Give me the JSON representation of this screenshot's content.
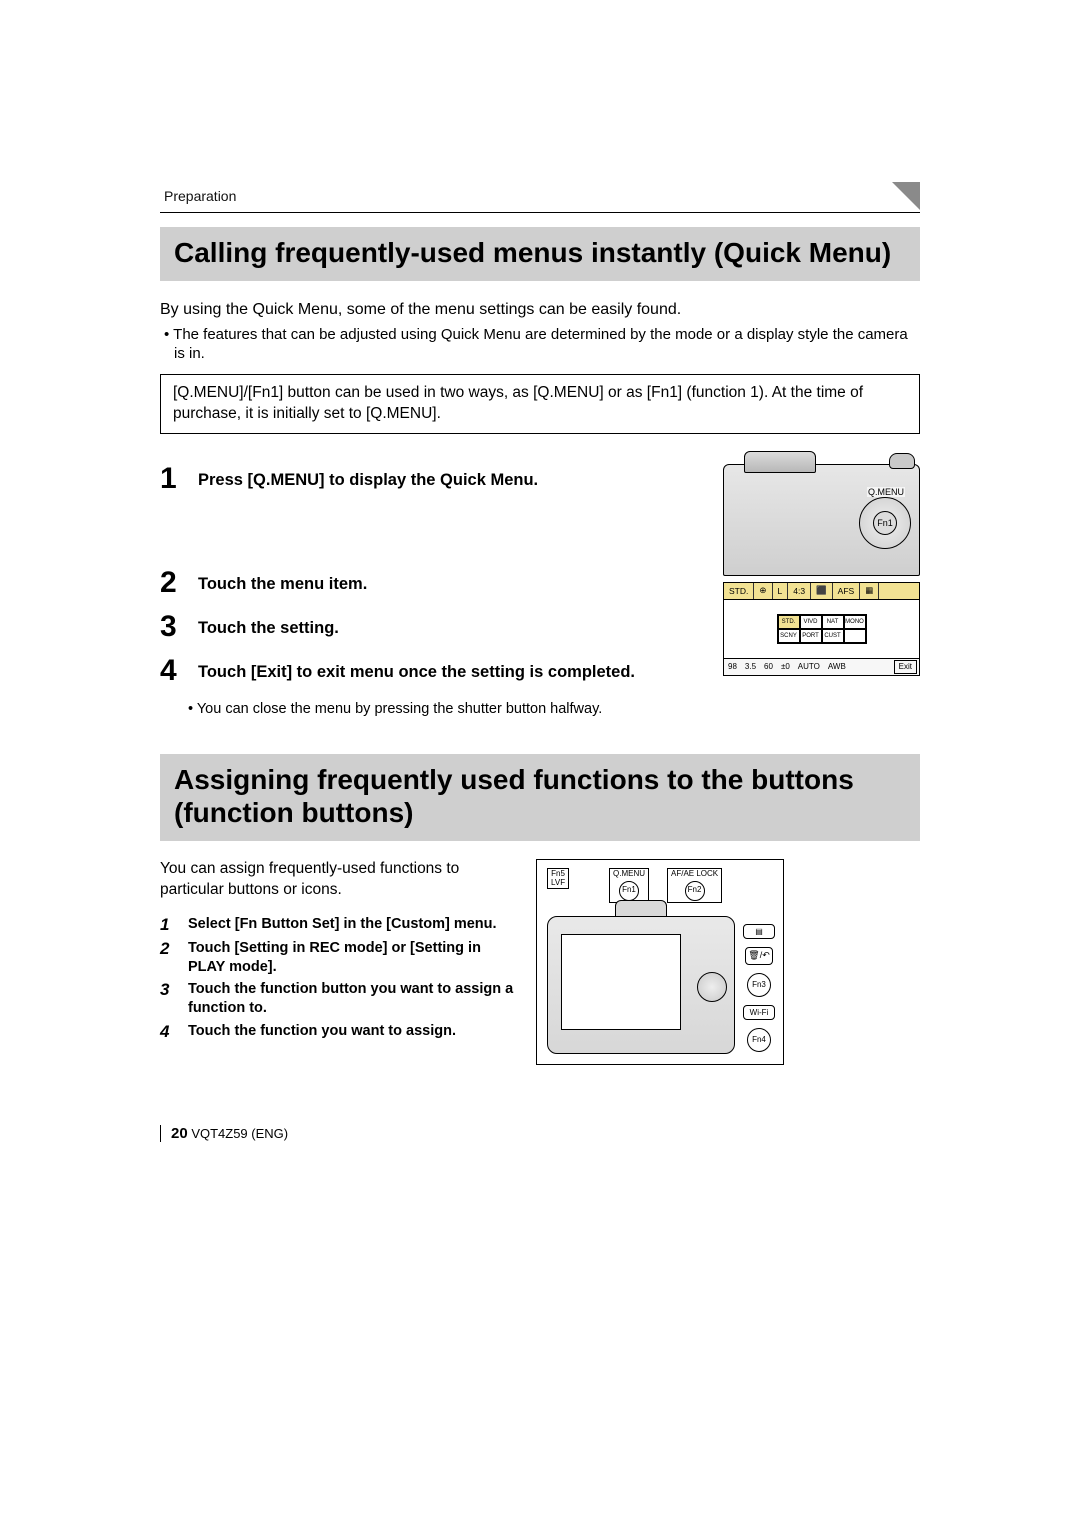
{
  "breadcrumb": "Preparation",
  "section1": {
    "title": "Calling frequently-used menus instantly (Quick Menu)",
    "intro": "By using the Quick Menu, some of the menu settings can be easily found.",
    "bullet": "The features that can be adjusted using Quick Menu are determined by the mode or a display style the camera is in.",
    "box": "[Q.MENU]/[Fn1] button can be used in two ways, as [Q.MENU] or as [Fn1] (function 1). At the time of purchase, it is initially set to [Q.MENU].",
    "steps": [
      {
        "n": "1",
        "t": "Press [Q.MENU] to display the Quick Menu."
      },
      {
        "n": "2",
        "t": "Touch the menu item."
      },
      {
        "n": "3",
        "t": "Touch the setting."
      },
      {
        "n": "4",
        "t": "Touch [Exit] to exit menu once the setting is completed."
      }
    ],
    "subnote": "You can close the menu by pressing the shutter button halfway.",
    "cam_labels": {
      "qmenu": "Q.MENU",
      "fn1": "Fn1"
    },
    "lcd": {
      "row1": [
        "STD.",
        "⊕",
        "L",
        "4:3",
        "⬛",
        "AFS",
        "▦"
      ],
      "grid": [
        "STD.",
        "VIVD",
        "NAT",
        "MONO",
        "SCNY",
        "PORT",
        "CUST"
      ],
      "bottom": {
        "iso": "98",
        "f": "3.5",
        "s": "60",
        "ev": "±0",
        "flash": "AUTO",
        "wb": "AWB",
        "exit": "Exit"
      }
    }
  },
  "section2": {
    "title": "Assigning frequently used functions to the buttons (function buttons)",
    "intro": "You can assign frequently-used functions to particular buttons or icons.",
    "steps": [
      {
        "n": "1",
        "t": "Select [Fn Button Set] in the [Custom] menu."
      },
      {
        "n": "2",
        "t": "Touch [Setting in REC mode] or [Setting in PLAY mode]."
      },
      {
        "n": "3",
        "t": "Touch the function button you want to assign a function to."
      },
      {
        "n": "4",
        "t": "Touch the function you want to assign."
      }
    ],
    "labels": {
      "fn5": "Fn5",
      "lvf": "LVF",
      "qmenu": "Q.MENU",
      "fn1": "Fn1",
      "afae": "AF/AE LOCK",
      "fn2": "Fn2",
      "fn3": "Fn3",
      "fn4": "Fn4",
      "wifi": "Wi-Fi",
      "trash": "🗑/↶"
    }
  },
  "footer": {
    "page": "20",
    "code": "VQT4Z59 (ENG)"
  }
}
